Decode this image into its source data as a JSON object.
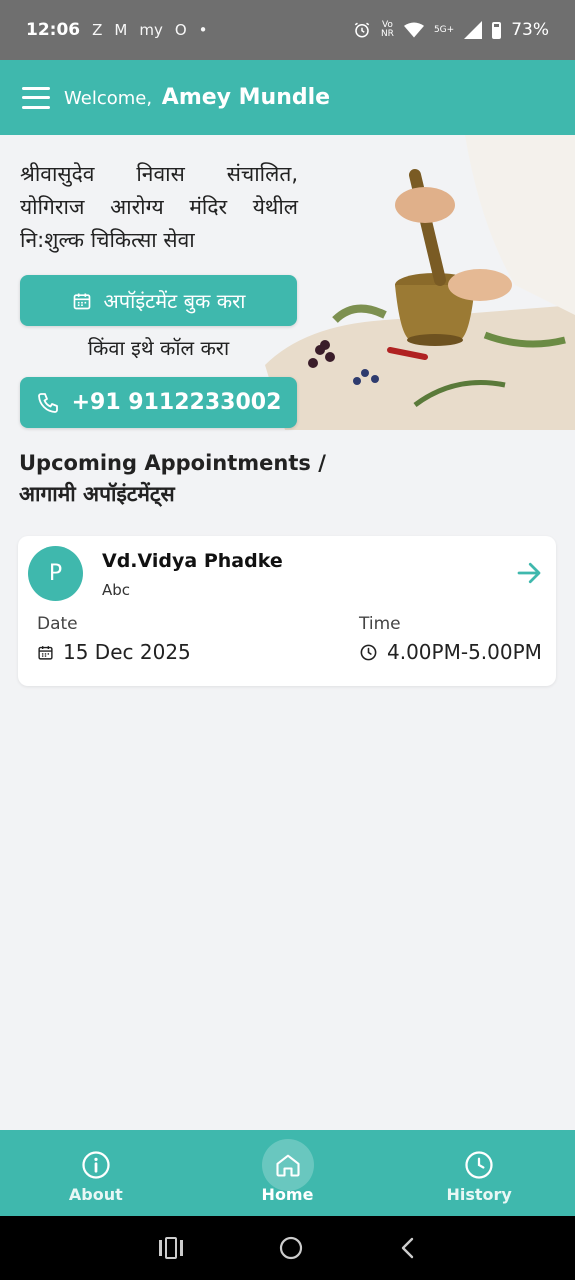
{
  "status_bar": {
    "time": "12:06",
    "left_icons": [
      "Z",
      "M",
      "my",
      "O",
      "•"
    ],
    "right_small": [
      "Vo",
      "NR"
    ],
    "signal_label": "5G+",
    "battery": "73%"
  },
  "header": {
    "welcome_label": "Welcome,",
    "user_name": "Amey Mundle"
  },
  "intro": {
    "text": "श्रीवासुदेव निवास संचालित, योगिराज आरोग्य मंदिर येथील नि:शुल्क चिकित्सा सेवा"
  },
  "actions": {
    "book_label": "अपॉइंटमेंट बुक करा",
    "or_call_text": "किंवा इथे कॉल करा",
    "phone": "+91 9112233002"
  },
  "upcoming": {
    "title_line1": "Upcoming Appointments /",
    "title_line2": "आगामी अपॉइंटमेंट्स",
    "appointments": [
      {
        "avatar_letter": "P",
        "doctor": "Vd.Vidya Phadke",
        "subtitle": "Abc",
        "date_label": "Date",
        "date": "15 Dec 2025",
        "time_label": "Time",
        "time": "4.00PM-5.00PM"
      }
    ]
  },
  "bottom_nav": {
    "items": [
      {
        "label": "About",
        "icon": "info-icon",
        "active": false
      },
      {
        "label": "Home",
        "icon": "home-icon",
        "active": true
      },
      {
        "label": "History",
        "icon": "clock-icon",
        "active": false
      }
    ]
  },
  "colors": {
    "accent": "#3fb8ad",
    "status_bar": "#6f6f6f",
    "background": "#f2f3f5"
  }
}
